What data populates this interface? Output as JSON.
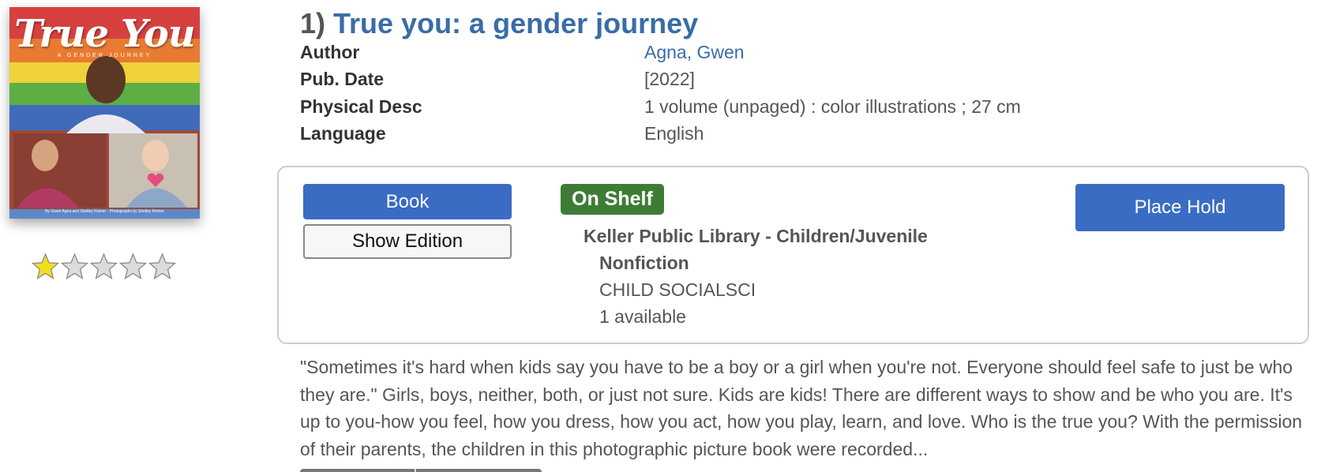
{
  "cover": {
    "title": "True You",
    "subtitle": "A GENDER JOURNEY",
    "credit": "By Gwen Agna and Shelley Rotner · Photographs by Shelley Rotner"
  },
  "rating": {
    "value": 1,
    "max": 5,
    "filled_color": "#f2e01d",
    "empty_color": "#dcdcdc"
  },
  "result": {
    "number": "1)",
    "title": "True you: a gender journey",
    "meta": {
      "author_label": "Author",
      "author_value": "Agna, Gwen",
      "pubdate_label": "Pub. Date",
      "pubdate_value": "[2022]",
      "physical_label": "Physical Desc",
      "physical_value": "1 volume (unpaged) : color illustrations ; 27 cm",
      "language_label": "Language",
      "language_value": "English"
    }
  },
  "holdings": {
    "format_button": "Book",
    "edition_button": "Show Edition",
    "status_badge": "On Shelf",
    "branch_line1": "Keller Public Library - Children/Juvenile",
    "branch_line2": "Nonfiction",
    "call_number": "CHILD SOCIALSCI",
    "availability": "1 available",
    "hold_button": "Place Hold"
  },
  "summary": "\"Sometimes it's hard when kids say you have to be a boy or a girl when you're not. Everyone should feel safe to just be who they are.\" Girls, boys, neither, both, or just not sure. Kids are kids! There are different ways to show and be who you are. It's up to you-how you feel, how you dress, how you act, how you play, learn, and love. Who is the true you? With the permission of their parents, the children in this photographic picture book were recorded...",
  "colors": {
    "link": "#3a6ca8",
    "primary_button": "#3a6cc4",
    "on_shelf": "#3e7c36"
  }
}
